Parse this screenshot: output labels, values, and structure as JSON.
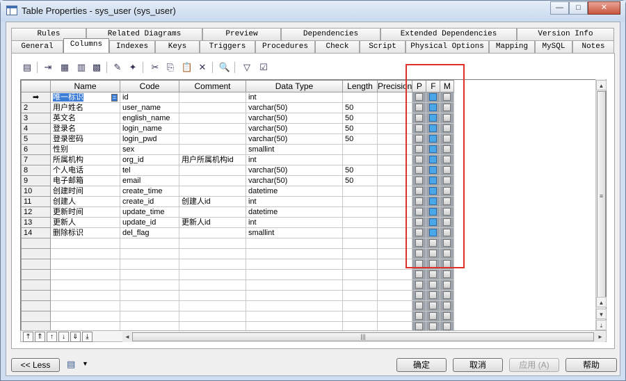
{
  "window": {
    "title": "Table Properties - sys_user (sys_user)",
    "controls": {
      "minimize": "—",
      "maximize": "□",
      "close": "✕"
    }
  },
  "tabs_top": [
    "Rules",
    "Related Diagrams",
    "Preview",
    "Dependencies",
    "Extended Dependencies",
    "Version Info"
  ],
  "tabs_bottom": [
    "General",
    "Columns",
    "Indexes",
    "Keys",
    "Triggers",
    "Procedures",
    "Check",
    "Script",
    "Physical Options",
    "Mapping",
    "MySQL",
    "Notes"
  ],
  "active_tab": "Columns",
  "toolbar": {
    "icons": [
      "properties-icon",
      "insert-row-icon",
      "add-row-icon",
      "add-columns-icon",
      "reuse-columns-icon",
      "new-icon",
      "create-column-icon",
      "cut-icon",
      "copy-icon",
      "paste-icon",
      "delete-icon",
      "find-icon",
      "filter-icon",
      "customize-columns-icon"
    ],
    "glyphs": [
      "▤",
      "⇥",
      "▦",
      "▥",
      "▩",
      "✎",
      "✦",
      "✂",
      "⎘",
      "📋",
      "✕",
      "🔍",
      "▽",
      "☑"
    ]
  },
  "grid": {
    "headers": [
      "Name",
      "Code",
      "Comment",
      "Data Type",
      "Length",
      "Precision",
      "P",
      "F",
      "M"
    ],
    "current_marker": "➡",
    "rows": [
      {
        "num": "",
        "name": "唯一标识",
        "code": "id",
        "comment": "",
        "type": "int",
        "length": "",
        "precision": "",
        "p": false,
        "f": true,
        "m": false
      },
      {
        "num": "2",
        "name": "用户姓名",
        "code": "user_name",
        "comment": "",
        "type": "varchar(50)",
        "length": "50",
        "precision": "",
        "p": false,
        "f": true,
        "m": false
      },
      {
        "num": "3",
        "name": "英文名",
        "code": "english_name",
        "comment": "",
        "type": "varchar(50)",
        "length": "50",
        "precision": "",
        "p": false,
        "f": true,
        "m": false
      },
      {
        "num": "4",
        "name": "登录名",
        "code": "login_name",
        "comment": "",
        "type": "varchar(50)",
        "length": "50",
        "precision": "",
        "p": false,
        "f": true,
        "m": false
      },
      {
        "num": "5",
        "name": "登录密码",
        "code": "login_pwd",
        "comment": "",
        "type": "varchar(50)",
        "length": "50",
        "precision": "",
        "p": false,
        "f": true,
        "m": false
      },
      {
        "num": "6",
        "name": "性别",
        "code": "sex",
        "comment": "",
        "type": "smallint",
        "length": "",
        "precision": "",
        "p": false,
        "f": true,
        "m": false
      },
      {
        "num": "7",
        "name": "所属机构",
        "code": "org_id",
        "comment": "用户所属机构id",
        "type": "int",
        "length": "",
        "precision": "",
        "p": false,
        "f": true,
        "m": false
      },
      {
        "num": "8",
        "name": "个人电话",
        "code": "tel",
        "comment": "",
        "type": "varchar(50)",
        "length": "50",
        "precision": "",
        "p": false,
        "f": true,
        "m": false
      },
      {
        "num": "9",
        "name": "电子邮箱",
        "code": "email",
        "comment": "",
        "type": "varchar(50)",
        "length": "50",
        "precision": "",
        "p": false,
        "f": true,
        "m": false
      },
      {
        "num": "10",
        "name": "创建时间",
        "code": "create_time",
        "comment": "",
        "type": "datetime",
        "length": "",
        "precision": "",
        "p": false,
        "f": true,
        "m": false
      },
      {
        "num": "11",
        "name": "创建人",
        "code": "create_id",
        "comment": "创建人id",
        "type": "int",
        "length": "",
        "precision": "",
        "p": false,
        "f": true,
        "m": false
      },
      {
        "num": "12",
        "name": "更新时间",
        "code": "update_time",
        "comment": "",
        "type": "datetime",
        "length": "",
        "precision": "",
        "p": false,
        "f": true,
        "m": false
      },
      {
        "num": "13",
        "name": "更新人",
        "code": "update_id",
        "comment": "更新人id",
        "type": "int",
        "length": "",
        "precision": "",
        "p": false,
        "f": true,
        "m": false
      },
      {
        "num": "14",
        "name": "删除标识",
        "code": "del_flag",
        "comment": "",
        "type": "smallint",
        "length": "",
        "precision": "",
        "p": false,
        "f": true,
        "m": false
      }
    ],
    "empty_rows": 9
  },
  "move_buttons": [
    "⤒",
    "⇑",
    "↑",
    "↓",
    "⇓",
    "⤓"
  ],
  "buttons": {
    "less": "<< Less",
    "ok": "确定",
    "cancel": "取消",
    "apply": "应用 (A)",
    "help": "帮助"
  },
  "colors": {
    "highlight_box": "#e0302a",
    "checked": "#4aa8e8",
    "selection": "#3a7bd5"
  }
}
